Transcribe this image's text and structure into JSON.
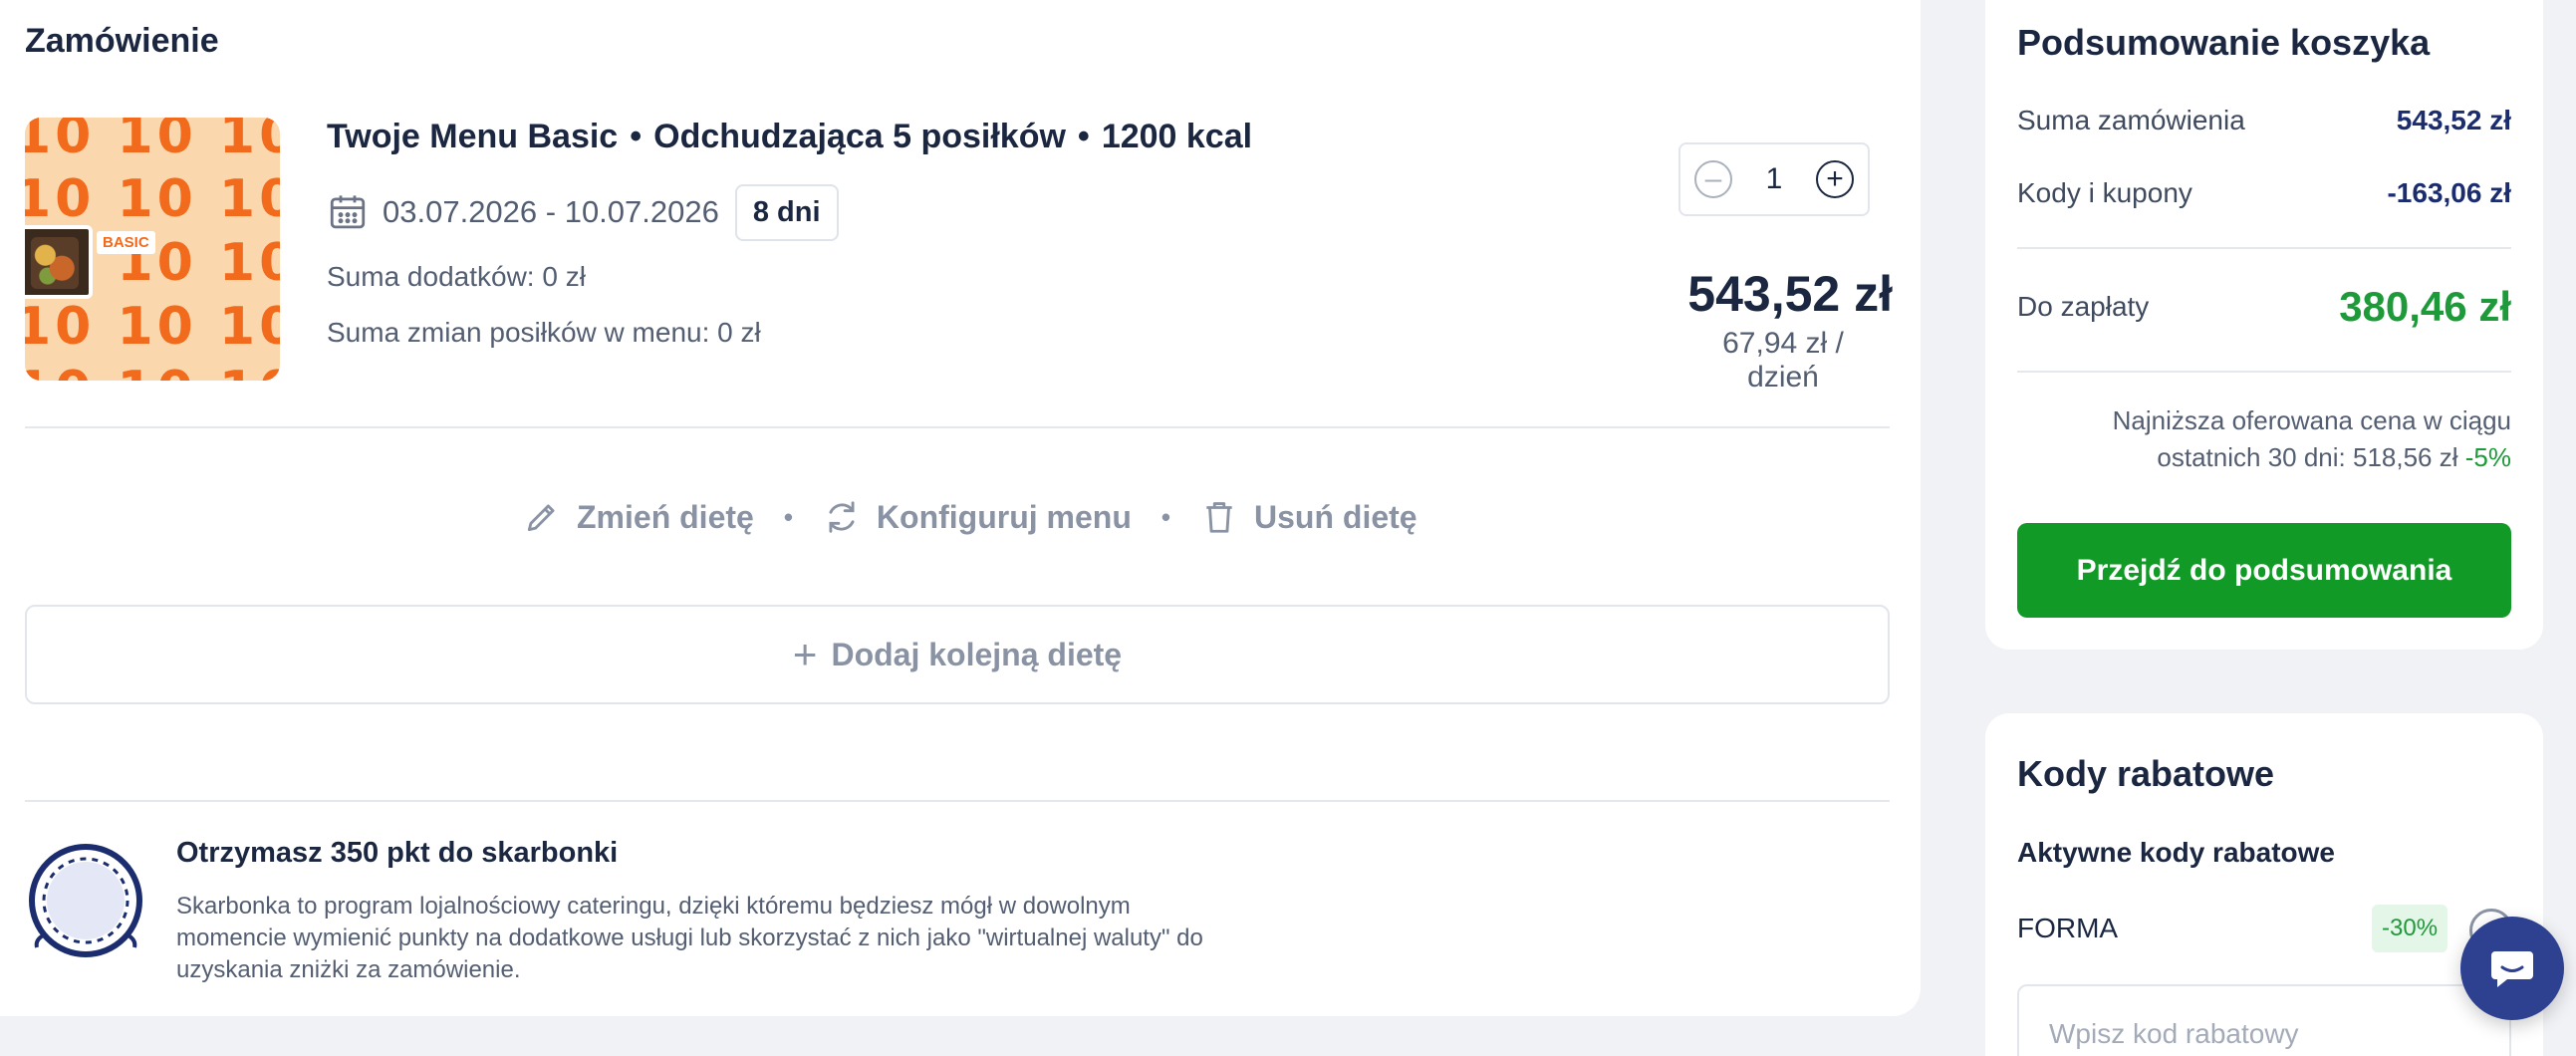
{
  "order": {
    "title": "Zamówienie",
    "thumb_badge": "BASIC",
    "thumb_pattern": "10 10 10 10\n10 10 10 10\n10 10 10 10\n10 10 10 10\n10 10 10 10",
    "product": {
      "name_part1": "Twoje Menu Basic",
      "name_part2": "Odchudzająca 5 posiłków",
      "name_part3": "1200 kcal",
      "separator": "•",
      "dates": "03.07.2026 - 10.07.2026",
      "days": "8 dni",
      "addons_sum": "Suma dodatków: 0 zł",
      "changes_sum": "Suma zmian posiłków w menu: 0 zł",
      "quantity": "1",
      "price": "543,52 zł",
      "price_per_day": "67,94 zł / dzień"
    },
    "actions": {
      "change": "Zmień dietę",
      "configure": "Konfiguruj menu",
      "remove": "Usuń dietę",
      "separator": "•"
    },
    "add_diet": "Dodaj kolejną dietę",
    "add_diet_icon": "+",
    "loyalty": {
      "title": "Otrzymasz 350 pkt do skarbonki",
      "description": "Skarbonka to program lojalnościowy cateringu, dzięki któremu będziesz mógł w dowolnym momencie wymienić punkty na dodatkowe usługi lub skorzystać z nich jako \"wirtualnej waluty\" do uzyskania zniżki za zamówienie."
    }
  },
  "summary": {
    "title": "Podsumowanie koszyka",
    "order_sum_label": "Suma zamówienia",
    "order_sum_value": "543,52 zł",
    "codes_label": "Kody i kupony",
    "codes_value": "-163,06 zł",
    "to_pay_label": "Do zapłaty",
    "to_pay_value": "380,46 zł",
    "lowest_price_text": "Najniższa oferowana cena w ciągu ostatnich 30 dni: 518,56 zł",
    "lowest_price_pct": "-5%",
    "cta": "Przejdź do podsumowania"
  },
  "discount_codes": {
    "title": "Kody rabatowe",
    "active_label": "Aktywne kody rabatowe",
    "code": "FORMA",
    "code_pct": "-30%",
    "input_placeholder": "Wpisz kod rabatowy"
  },
  "colors": {
    "accent_green": "#129a27",
    "price_green": "#1f9a3a",
    "navy": "#1b2740",
    "chat_blue": "#2d4190",
    "thumb_orange": "#f26a1b"
  },
  "icons": [
    "calendar-icon",
    "minus-icon",
    "plus-icon",
    "pencil-icon",
    "refresh-icon",
    "trash-icon",
    "plus-icon",
    "coin-icon",
    "remove-circle-icon",
    "chat-icon"
  ]
}
